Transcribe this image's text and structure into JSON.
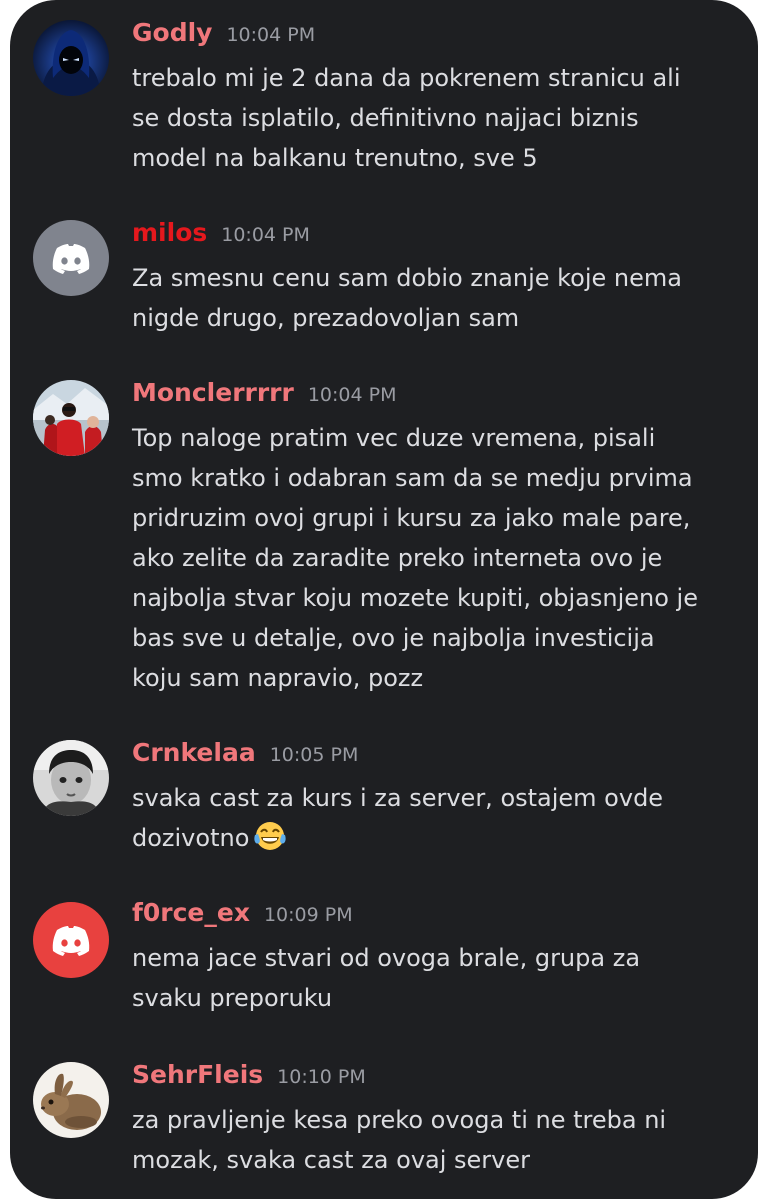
{
  "messages": [
    {
      "username": "Godly",
      "time": "10:04 PM",
      "avatar": "hooded-figure-avatar",
      "lines": [
        "trebalo mi je 2 dana da pokrenem stranicu ali",
        "se dosta isplatilo, definitivno najjaci biznis",
        "model na balkanu trenutno, sve 5"
      ]
    },
    {
      "username": "milos",
      "time": "10:04 PM",
      "avatar": "discord-default-grey-avatar",
      "lines": [
        "Za smesnu cenu sam dobio znanje koje nema",
        "nigde drugo, prezadovoljan sam"
      ]
    },
    {
      "username": "Monclerrrrr",
      "time": "10:04 PM",
      "avatar": "red-jackets-photo-avatar",
      "lines": [
        "Top naloge pratim vec duze vremena, pisali",
        "smo kratko i odabran sam da se medju prvima",
        "pridruzim ovoj grupi i kursu za jako male pare,",
        "ako zelite da zaradite preko interneta ovo je",
        "najbolja stvar koju mozete kupiti, objasnjeno je",
        "bas sve u detalje, ovo je najbolja investicija",
        "koju sam napravio, pozz"
      ]
    },
    {
      "username": "Crnkelaa",
      "time": "10:05 PM",
      "avatar": "child-bw-photo-avatar",
      "lines": [
        "svaka cast za kurs i za server, ostajem ovde",
        "dozivotno"
      ],
      "emoji": "tears-of-joy-emoji"
    },
    {
      "username": "f0rce_ex",
      "time": "10:09 PM",
      "avatar": "discord-default-red-avatar",
      "lines": [
        "nema jace stvari od ovoga brale, grupa za",
        "svaku preporuku"
      ]
    },
    {
      "username": "SehrFleis",
      "time": "10:10 PM",
      "avatar": "rabbit-photo-avatar",
      "lines": [
        "za pravljenje kesa preko ovoga ti ne treba ni",
        "mozak, svaka cast za ovaj server"
      ]
    }
  ],
  "colors": {
    "background": "#1e1f22",
    "username": "#f0777b",
    "username_milos": "#e5181d",
    "timestamp": "#9a9ca3",
    "text": "#dcdde1",
    "discord_grey": "#80848e",
    "discord_red": "#e8413f"
  }
}
